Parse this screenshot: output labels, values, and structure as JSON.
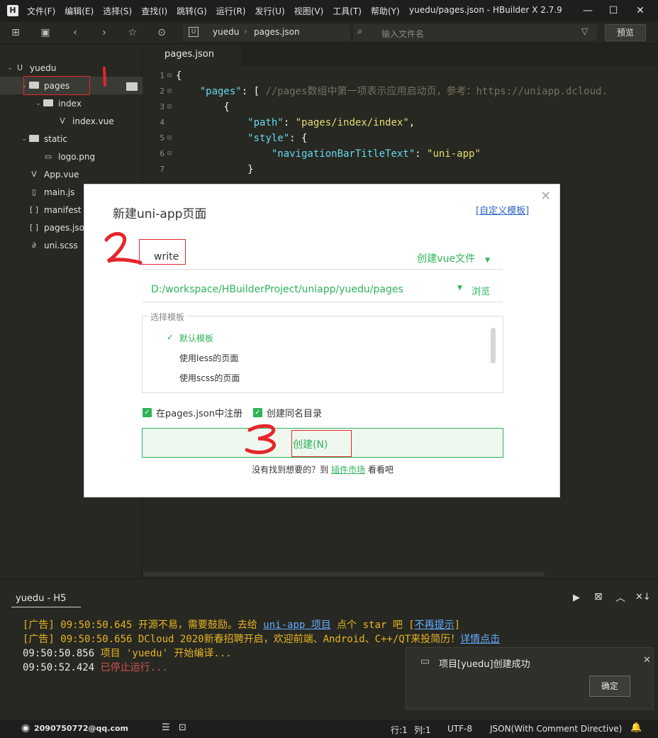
{
  "menubar": {
    "logo": "H",
    "items": [
      "文件(F)",
      "编辑(E)",
      "选择(S)",
      "查找(I)",
      "跳转(G)",
      "运行(R)",
      "发行(U)",
      "视图(V)",
      "工具(T)",
      "帮助(Y)"
    ],
    "title": "yuedu/pages.json - HBuilder X 2.7.9"
  },
  "toolbar": {
    "breadcrumb": [
      "yuedu",
      "pages.json"
    ],
    "search_placeholder": "输入文件名",
    "preview": "预览"
  },
  "sidebar": {
    "items": [
      {
        "label": "yuedu",
        "level": 0,
        "kind": "project",
        "open": true
      },
      {
        "label": "pages",
        "level": 1,
        "kind": "folder",
        "open": true
      },
      {
        "label": "index",
        "level": 2,
        "kind": "folder",
        "open": true
      },
      {
        "label": "index.vue",
        "level": 3,
        "kind": "vue"
      },
      {
        "label": "static",
        "level": 1,
        "kind": "folder",
        "open": true
      },
      {
        "label": "logo.png",
        "level": 2,
        "kind": "image"
      },
      {
        "label": "App.vue",
        "level": 1,
        "kind": "vue"
      },
      {
        "label": "main.js",
        "level": 1,
        "kind": "js"
      },
      {
        "label": "manifest",
        "level": 1,
        "kind": "json"
      },
      {
        "label": "pages.json",
        "level": 1,
        "kind": "json"
      },
      {
        "label": "uni.scss",
        "level": 1,
        "kind": "scss"
      }
    ]
  },
  "editor": {
    "tab": "pages.json",
    "lines": [
      {
        "n": "1",
        "code": "{"
      },
      {
        "n": "2",
        "code": "    \"pages\": [ //pages数组中第一项表示应用启动页，参考：https://uniapp.dcloud."
      },
      {
        "n": "3",
        "code": "        {"
      },
      {
        "n": "4",
        "code": "            \"path\": \"pages/index/index\","
      },
      {
        "n": "5",
        "code": "            \"style\": {"
      },
      {
        "n": "6",
        "code": "                \"navigationBarTitleText\": \"uni-app\""
      },
      {
        "n": "7",
        "code": "            }"
      }
    ]
  },
  "dialog": {
    "title": "新建uni-app页面",
    "custom_template": "[自定义模板]",
    "name_value": "write",
    "file_type": "创建vue文件",
    "path": "D:/workspace/HBuilderProject/uniapp/yuedu/pages",
    "browse": "浏览",
    "templates_label": "选择模板",
    "templates": [
      "默认模板",
      "使用less的页面",
      "使用scss的页面"
    ],
    "checkbox_register": "在pages.json中注册",
    "checkbox_dir": "创建同名目录",
    "create": "创建(N)",
    "hint_pre": "没有找到想要的？到 ",
    "hint_link": "插件市场",
    "hint_post": " 看看吧"
  },
  "console": {
    "tab": "yuedu - H5",
    "lines": [
      {
        "parts": [
          {
            "t": "[广告] 09:50:50.645 开源不易，需要鼓励。去给 ",
            "c": "cy"
          },
          {
            "t": "uni-app 项目",
            "c": "cb"
          },
          {
            "t": " 点个 star 吧 [",
            "c": "cy"
          },
          {
            "t": "不再提示",
            "c": "cb"
          },
          {
            "t": "]",
            "c": "cy"
          }
        ]
      },
      {
        "parts": [
          {
            "t": "[广告] 09:50:50.656 DCloud 2020新春招聘开启，欢迎前端、Android、C++/QT来投简历！",
            "c": "cy"
          },
          {
            "t": "详情点击",
            "c": "cb"
          }
        ]
      },
      {
        "parts": [
          {
            "t": "09:50:50.856 ",
            "c": "cw"
          },
          {
            "t": "项目 'yuedu' 开始编译...",
            "c": "cy"
          }
        ]
      },
      {
        "parts": [
          {
            "t": "09:50:52.424 ",
            "c": "cw"
          },
          {
            "t": "已停止运行...",
            "c": "cr"
          }
        ]
      }
    ]
  },
  "toast": {
    "message": "项目[yuedu]创建成功",
    "ok": "确定"
  },
  "statusbar": {
    "user": "2090750772@qq.com",
    "line": "行:1",
    "col": "列:1",
    "encoding": "UTF-8",
    "lang": "JSON(With Comment Directive)"
  },
  "annotations": [
    "1",
    "2",
    "3"
  ]
}
